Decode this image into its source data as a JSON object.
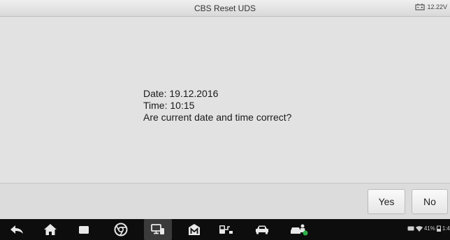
{
  "titlebar": {
    "title": "CBS Reset UDS",
    "voltage": "12.22V",
    "battery_icon": "car-battery-icon"
  },
  "dialog": {
    "date_line": "Date: 19.12.2016",
    "time_line": "Time: 10:15",
    "question": "Are current date and time correct?"
  },
  "buttons": {
    "yes_label": "Yes",
    "no_label": "No"
  },
  "navbar": {
    "icons": [
      "back-icon",
      "home-icon",
      "recent-apps-icon",
      "chrome-icon",
      "remote-desktop-icon",
      "maxifix-icon",
      "diagnostics-icon",
      "car-icon",
      "service-icon"
    ],
    "status": {
      "battery_percent": "41%",
      "clock": "1:4"
    }
  },
  "colors": {
    "background": "#e2e2e2",
    "navbar": "#0d0d0d",
    "service_badge": "#2db34a"
  }
}
